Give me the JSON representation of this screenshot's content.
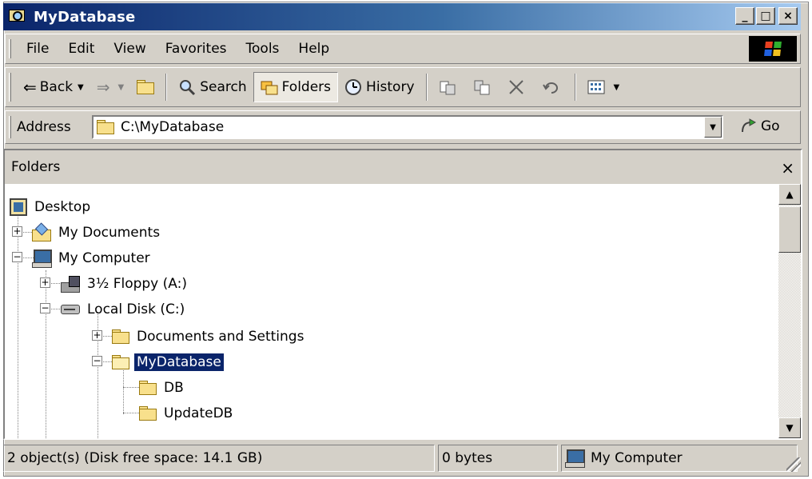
{
  "window": {
    "title": "MyDatabase"
  },
  "title_buttons": {
    "minimize": "_",
    "maximize": "□",
    "close": "×"
  },
  "menu": [
    "File",
    "Edit",
    "View",
    "Favorites",
    "Tools",
    "Help"
  ],
  "toolbar": {
    "back": "Back",
    "search": "Search",
    "folders": "Folders",
    "history": "History"
  },
  "address": {
    "label": "Address",
    "value": "C:\\MyDatabase",
    "go": "Go"
  },
  "folders_pane": {
    "title": "Folders",
    "close": "×",
    "tree": [
      {
        "label": "Desktop"
      },
      {
        "label": "My Documents"
      },
      {
        "label": "My Computer"
      },
      {
        "label": "3½ Floppy (A:)"
      },
      {
        "label": "Local Disk (C:)"
      },
      {
        "label": "Documents and Settings"
      },
      {
        "label": "MyDatabase",
        "selected": true
      },
      {
        "label": "DB"
      },
      {
        "label": "UpdateDB"
      }
    ]
  },
  "status": {
    "objects": "2 object(s) (Disk free space: 14.1 GB)",
    "size": "0 bytes",
    "zone": "My Computer"
  },
  "colors": {
    "title_start": "#0a246a",
    "title_end": "#a6caf0",
    "selection": "#0a246a",
    "chrome": "#d4d0c8"
  },
  "icons": [
    "explorer-icon",
    "windows-logo-icon",
    "back-arrow-icon",
    "forward-arrow-icon",
    "up-folder-icon",
    "search-icon",
    "folders-icon",
    "history-icon",
    "move-to-icon",
    "copy-to-icon",
    "delete-icon",
    "undo-icon",
    "views-icon",
    "folder-icon",
    "go-icon",
    "desktop-icon",
    "my-documents-icon",
    "my-computer-icon",
    "floppy-icon",
    "local-disk-icon"
  ]
}
